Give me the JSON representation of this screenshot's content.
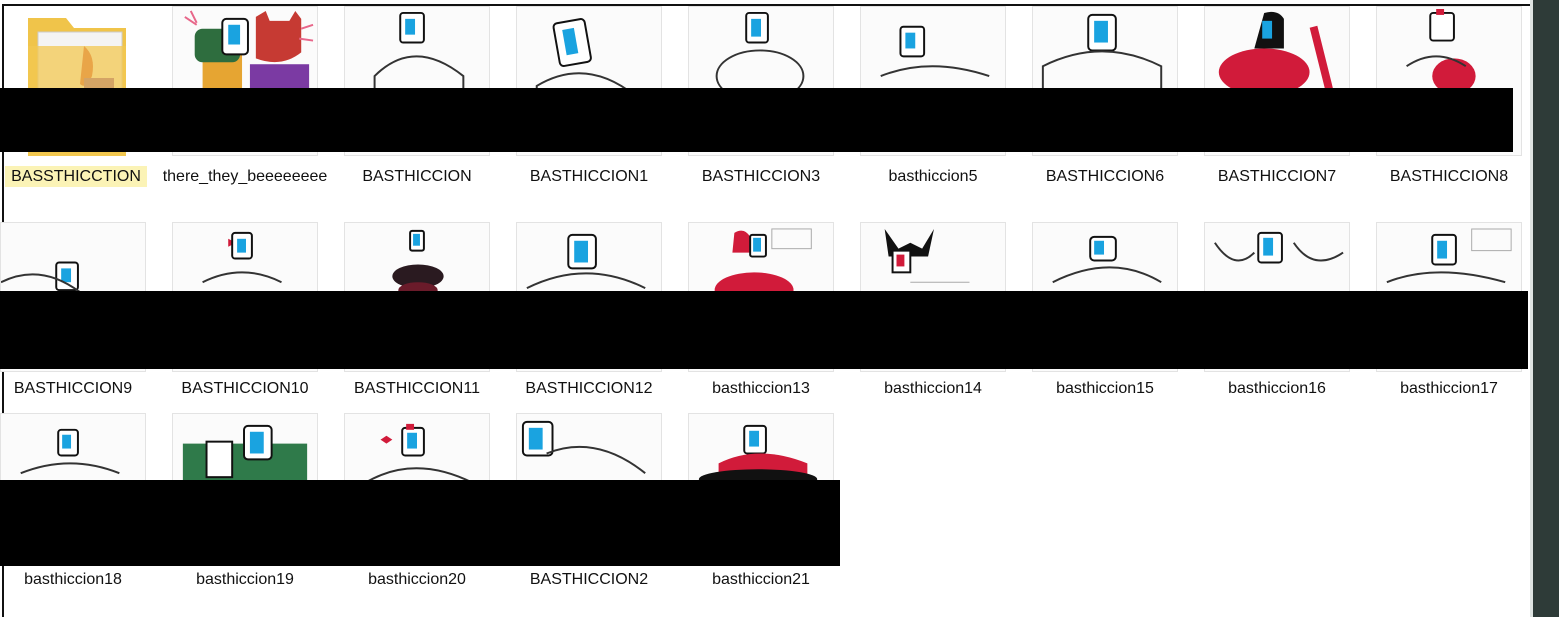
{
  "explorer": {
    "view": "large icons",
    "items": [
      {
        "name": "BASSTHICCTION",
        "kind": "folder",
        "selected": true
      },
      {
        "name": "there_they_beeeeeeee",
        "kind": "image"
      },
      {
        "name": "BASTHICCION",
        "kind": "image"
      },
      {
        "name": "BASTHICCION1",
        "kind": "image"
      },
      {
        "name": "BASTHICCION3",
        "kind": "image"
      },
      {
        "name": "basthiccion5",
        "kind": "image"
      },
      {
        "name": "BASTHICCION6",
        "kind": "image"
      },
      {
        "name": "BASTHICCION7",
        "kind": "image"
      },
      {
        "name": "BASTHICCION8",
        "kind": "image"
      },
      {
        "name": "BASTHICCION9",
        "kind": "image"
      },
      {
        "name": "BASTHICCION10",
        "kind": "image"
      },
      {
        "name": "BASTHICCION11",
        "kind": "image"
      },
      {
        "name": "BASTHICCION12",
        "kind": "image"
      },
      {
        "name": "basthiccion13",
        "kind": "image"
      },
      {
        "name": "basthiccion14",
        "kind": "image"
      },
      {
        "name": "basthiccion15",
        "kind": "image"
      },
      {
        "name": "basthiccion16",
        "kind": "image"
      },
      {
        "name": "basthiccion17",
        "kind": "image"
      },
      {
        "name": "basthiccion18",
        "kind": "image"
      },
      {
        "name": "basthiccion19",
        "kind": "image"
      },
      {
        "name": "basthiccion20",
        "kind": "image"
      },
      {
        "name": "BASTHICCION2",
        "kind": "image"
      },
      {
        "name": "basthiccion21",
        "kind": "image"
      }
    ]
  },
  "colors": {
    "selection": "#fbf3b6",
    "redaction": "#000000",
    "side_strip": "#2e3b38",
    "screen_blue": "#1aa3e0",
    "accent_red": "#d11b3a"
  }
}
